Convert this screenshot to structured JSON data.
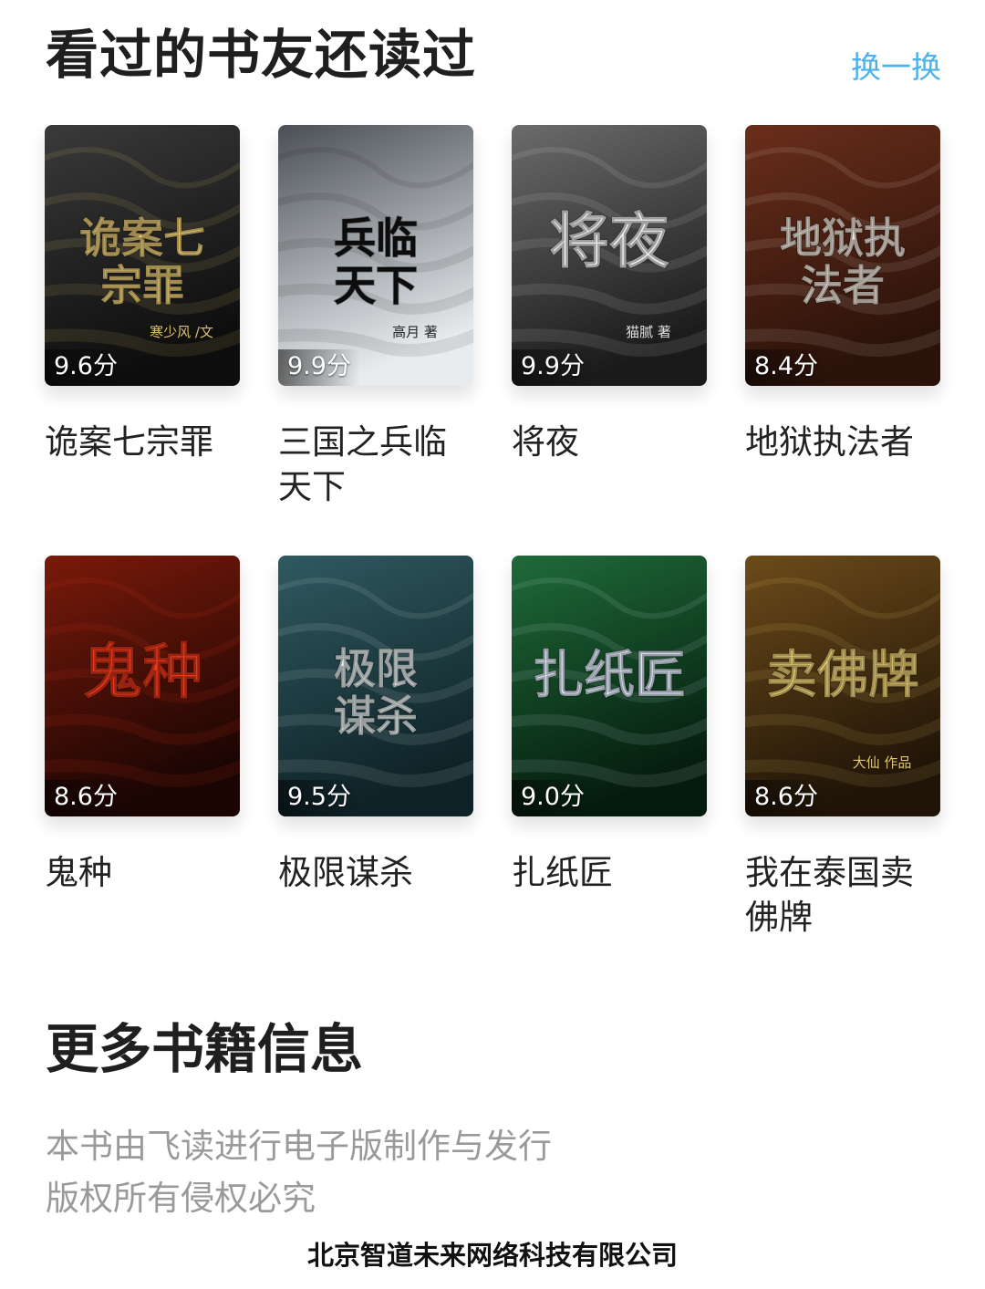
{
  "section": {
    "title": "看过的书友还读过",
    "refresh_label": "换一换"
  },
  "books": [
    {
      "title": "诡案七宗罪",
      "score": "9.6分",
      "cover_text": "诡案七宗罪",
      "cover_author": "寒少风 /文",
      "cover_colors": [
        "#0d0d0d",
        "#3a3a3a",
        "#f3d37a"
      ]
    },
    {
      "title": "三国之兵临天下",
      "score": "9.9分",
      "cover_text": "兵临天下",
      "cover_author": "高月 著",
      "cover_colors": [
        "#e8ecef",
        "#4a4f55",
        "#111111"
      ]
    },
    {
      "title": "将夜",
      "score": "9.9分",
      "cover_text": "将夜",
      "cover_author": "猫腻 著",
      "cover_colors": [
        "#1a1a1a",
        "#6b6b6b",
        "#f5f5f5"
      ]
    },
    {
      "title": "地狱执法者",
      "score": "8.4分",
      "cover_text": "地狱执法者",
      "cover_author": "",
      "cover_colors": [
        "#2a120a",
        "#6a2e1a",
        "#f3eadf"
      ]
    },
    {
      "title": "鬼种",
      "score": "8.6分",
      "cover_text": "鬼种",
      "cover_author": "",
      "cover_colors": [
        "#1a0503",
        "#7a1a0a",
        "#e8371a"
      ]
    },
    {
      "title": "极限谋杀",
      "score": "9.5分",
      "cover_text": "极限谋杀",
      "cover_author": "",
      "cover_colors": [
        "#0e2227",
        "#2f5a60",
        "#eaf3f3"
      ]
    },
    {
      "title": "扎纸匠",
      "score": "9.0分",
      "cover_text": "扎纸匠",
      "cover_author": "",
      "cover_colors": [
        "#051c0d",
        "#1f6b3a",
        "#e6f1ff"
      ]
    },
    {
      "title": "我在泰国卖佛牌",
      "score": "8.6分",
      "cover_text": "卖佛牌",
      "cover_author": "大仙 作品",
      "cover_colors": [
        "#1f1407",
        "#6d4b1a",
        "#f5d77a"
      ]
    }
  ],
  "more_info": {
    "title": "更多书籍信息",
    "line1": "本书由飞读进行电子版制作与发行",
    "line2": "版权所有侵权必究"
  },
  "footer": {
    "company": "北京智道未来网络科技有限公司"
  }
}
